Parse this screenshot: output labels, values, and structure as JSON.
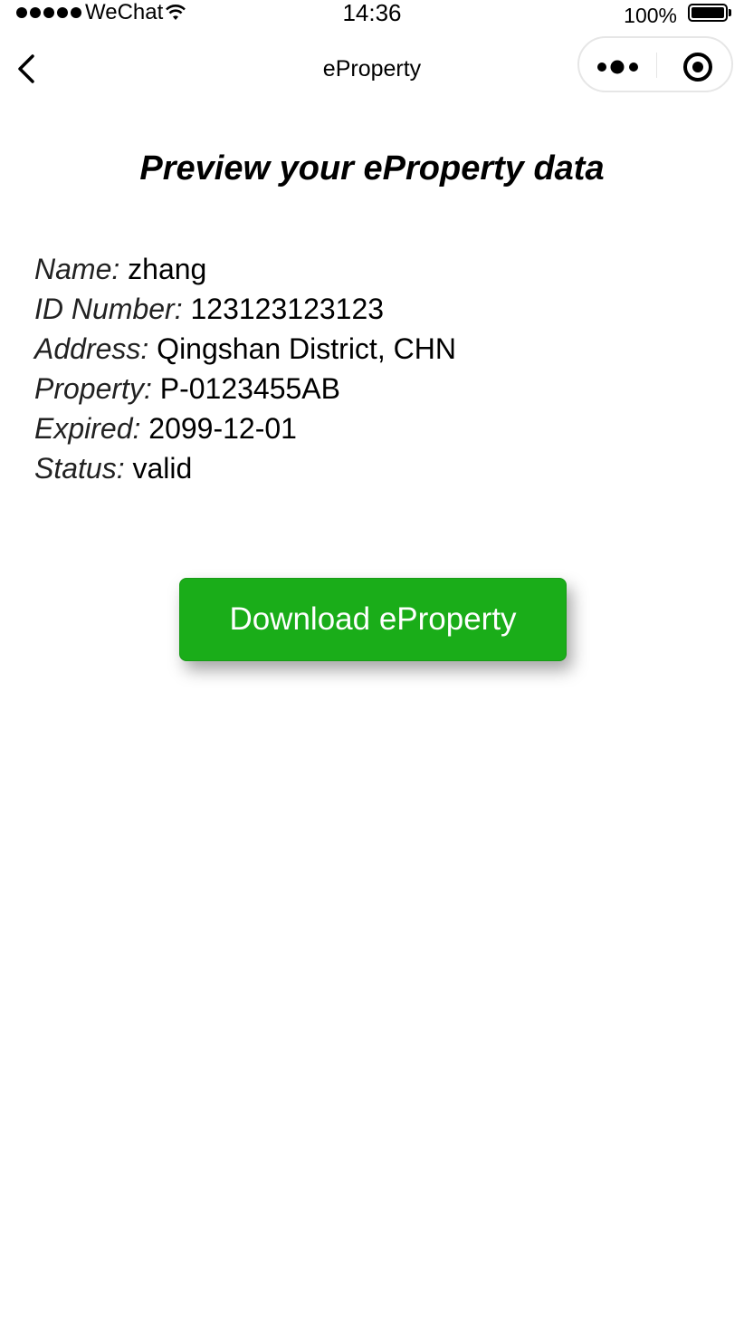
{
  "status_bar": {
    "carrier": "WeChat",
    "time": "14:36",
    "battery": "100%",
    "signal_icon": "signal-dots-icon",
    "wifi_icon": "wifi-icon",
    "battery_icon": "battery-icon"
  },
  "nav": {
    "title": "eProperty",
    "back_icon": "chevron-left-icon",
    "more_icon": "more-dots-icon",
    "close_icon": "target-circle-icon"
  },
  "heading": "Preview your eProperty data",
  "info": [
    {
      "label": "Name:",
      "value": "zhang"
    },
    {
      "label": "ID Number:",
      "value": "123123123123"
    },
    {
      "label": "Address:",
      "value": "Qingshan District, CHN"
    },
    {
      "label": "Property:",
      "value": "P-0123455AB"
    },
    {
      "label": "Expired:",
      "value": "2099-12-01"
    },
    {
      "label": "Status:",
      "value": "valid"
    }
  ],
  "download_button": {
    "label": "Download eProperty",
    "color": "#1aad19"
  }
}
